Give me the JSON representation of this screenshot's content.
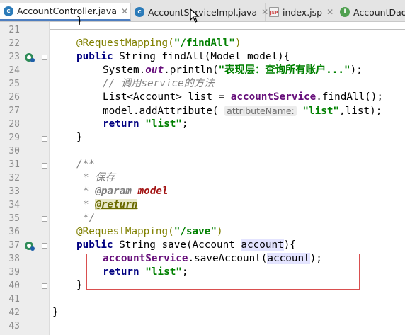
{
  "tabs": [
    {
      "label": "AccountController.java",
      "icon": "class-icon",
      "active": true,
      "closable": true
    },
    {
      "label": "AccountServiceImpl.java",
      "icon": "class-icon",
      "active": false,
      "closable": true
    },
    {
      "label": "index.jsp",
      "icon": "jsp-file-icon",
      "active": false,
      "closable": true
    },
    {
      "label": "AccountDao",
      "icon": "interface-icon",
      "active": false,
      "closable": false
    }
  ],
  "editor": {
    "lines": [
      {
        "n": "21",
        "code": ""
      },
      {
        "n": "22",
        "code": "@RequestMapping(\"/findAll\")"
      },
      {
        "n": "23",
        "code": "public String findAll(Model model){"
      },
      {
        "n": "24",
        "code": "System.out.println(\"表现层：查询所有账户...\");"
      },
      {
        "n": "25",
        "code": "// 调用service的方法"
      },
      {
        "n": "26",
        "code": "List<Account> list = accountService.findAll();"
      },
      {
        "n": "27",
        "code": "model.addAttribute( attributeName: \"list\",list);"
      },
      {
        "n": "28",
        "code": "return \"list\";"
      },
      {
        "n": "29",
        "code": "}"
      },
      {
        "n": "30",
        "code": ""
      },
      {
        "n": "31",
        "code": "/**"
      },
      {
        "n": "32",
        "code": "* 保存"
      },
      {
        "n": "33",
        "code": "* @param model"
      },
      {
        "n": "34",
        "code": "* @return"
      },
      {
        "n": "35",
        "code": "*/"
      },
      {
        "n": "36",
        "code": "@RequestMapping(\"/save\")"
      },
      {
        "n": "37",
        "code": "public String save(Account account){"
      },
      {
        "n": "38",
        "code": "accountService.saveAccount(account);"
      },
      {
        "n": "39",
        "code": "return \"list\";"
      },
      {
        "n": "40",
        "code": "}"
      },
      {
        "n": "41",
        "code": ""
      },
      {
        "n": "42",
        "code": "}"
      },
      {
        "n": "43",
        "code": ""
      }
    ],
    "gutter_icons": [
      "spring-bean-method-icon",
      "fold-marker-icon"
    ],
    "selection_box": "red highlight rectangle around lines 38-40"
  },
  "colors": {
    "keyword": "#000080",
    "string": "#008000",
    "annotation": "#808000",
    "comment": "#808080",
    "field": "#660e7a",
    "selection_box": "#d94f4f",
    "active_tab_underline": "#4e7ec0"
  }
}
